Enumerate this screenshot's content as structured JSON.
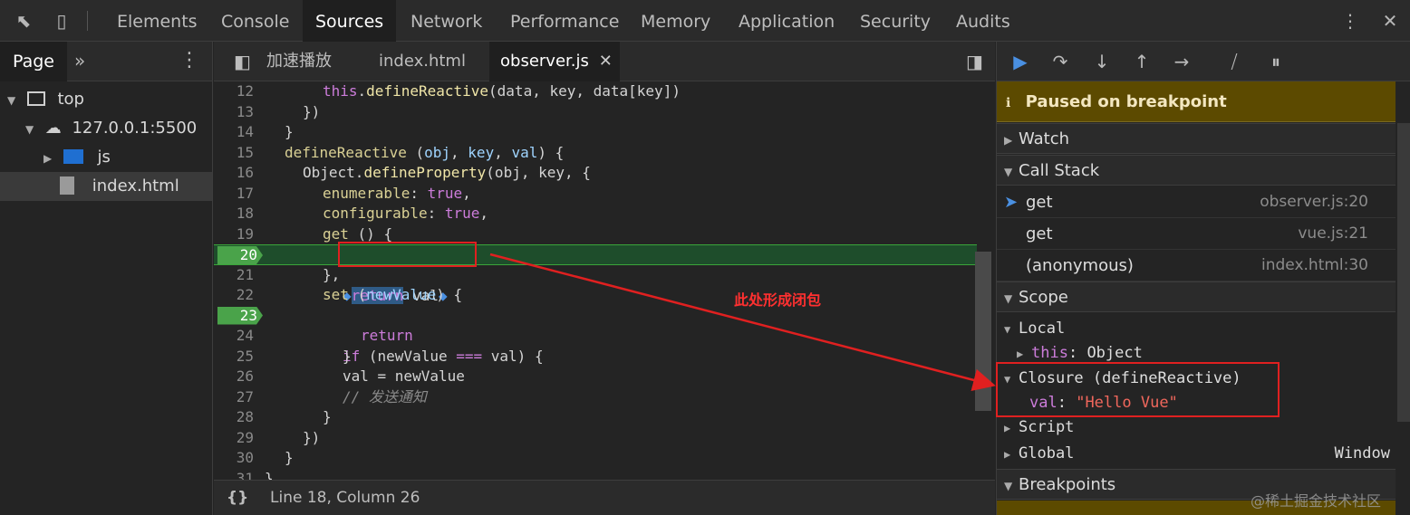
{
  "topbar": {
    "tabs": [
      "Elements",
      "Console",
      "Sources",
      "Network",
      "Performance",
      "Memory",
      "Application",
      "Security",
      "Audits"
    ],
    "active": "Sources"
  },
  "navigator": {
    "tab_page": "Page",
    "more": "»",
    "tree": {
      "top": "top",
      "host": "127.0.0.1:5500",
      "folder": "js",
      "file": "index.html"
    }
  },
  "editor": {
    "tabs": [
      "加速播放",
      "index.html",
      "observer.js"
    ],
    "active_tab": "observer.js",
    "lines": [
      {
        "n": "12",
        "code": "this.defineReactive(data, key, data[key])"
      },
      {
        "n": "13",
        "code": "})"
      },
      {
        "n": "14",
        "code": "}"
      },
      {
        "n": "15",
        "code": "defineReactive (obj, key, val) {"
      },
      {
        "n": "16",
        "code": "Object.defineProperty(obj, key, {"
      },
      {
        "n": "17",
        "code": "enumerable: true,"
      },
      {
        "n": "18",
        "code": "configurable: true,"
      },
      {
        "n": "19",
        "code": "get () {"
      },
      {
        "n": "20",
        "code": "return val"
      },
      {
        "n": "21",
        "code": "},"
      },
      {
        "n": "22",
        "code": "set (newValue) {"
      },
      {
        "n": "23",
        "code": "if (newValue === val) {"
      },
      {
        "n": "24",
        "code": "return"
      },
      {
        "n": "25",
        "code": "}"
      },
      {
        "n": "26",
        "code": "val = newValue"
      },
      {
        "n": "27",
        "code": "// 发送通知"
      },
      {
        "n": "28",
        "code": "}"
      },
      {
        "n": "29",
        "code": "})"
      },
      {
        "n": "30",
        "code": "}"
      },
      {
        "n": "31",
        "code": "}"
      }
    ],
    "breakpoint_lines": [
      "20",
      "23"
    ],
    "status": "Line 18, Column 26",
    "format_icon": "{}"
  },
  "debugger": {
    "paused": "Paused on breakpoint",
    "sections": {
      "watch": "Watch",
      "call_stack": "Call Stack",
      "scope": "Scope",
      "breakpoints": "Breakpoints"
    },
    "call_stack": [
      {
        "name": "get",
        "loc": "observer.js:20"
      },
      {
        "name": "get",
        "loc": "vue.js:21"
      },
      {
        "name": "(anonymous)",
        "loc": "index.html:30"
      }
    ],
    "scope": {
      "local": "Local",
      "this_name": "this",
      "this_value": "Object",
      "closure": "Closure (defineReactive)",
      "closure_var": "val",
      "closure_val": "\"Hello Vue\"",
      "script": "Script",
      "global": "Global",
      "global_val": "Window"
    }
  },
  "annotation": {
    "text": "此处形成闭包",
    "color": "#e02020"
  },
  "watermark": "@稀土掘金技术社区"
}
